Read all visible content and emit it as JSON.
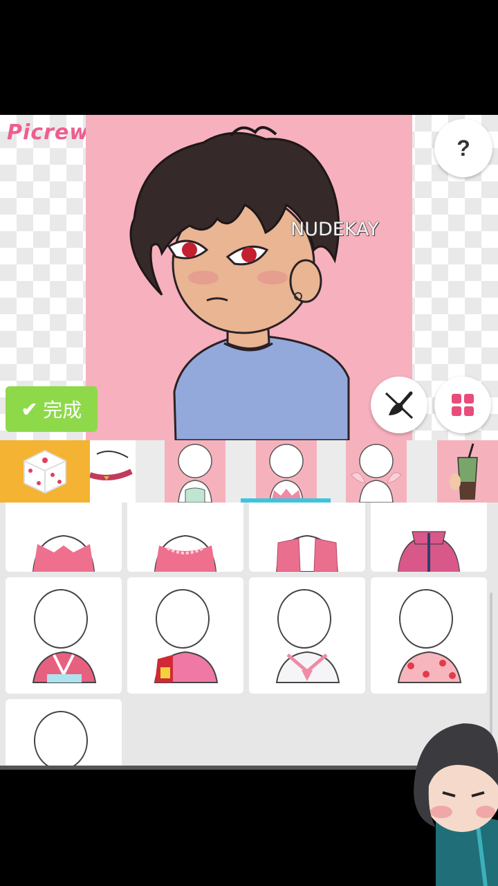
{
  "app": {
    "logo": "Picrew",
    "watermark": "NUDEKAY"
  },
  "buttons": {
    "help_label": "?",
    "done_label": "完成",
    "done_icon": "check-icon",
    "brush_icon": "brush-toggle-icon",
    "grid_icon": "grid-icon",
    "random_icon": "dice-icon"
  },
  "category_tabs": [
    {
      "name": "choker",
      "selected": false
    },
    {
      "name": "inner-shirt",
      "selected": false
    },
    {
      "name": "outer-top",
      "selected": true
    },
    {
      "name": "wings",
      "selected": false
    },
    {
      "name": "bubble-tea",
      "selected": false
    }
  ],
  "items": [
    "pink-tshirt",
    "pink-frill-top",
    "pink-open-jacket",
    "pink-track-jacket",
    "pink-kimono",
    "pink-bomber-jacket",
    "sailor-top",
    "strawberry-shirt",
    "partial-item"
  ],
  "colors": {
    "portrait_bg": "#f7b0be",
    "done_green": "#8ed94a",
    "dice_orange": "#f4b332",
    "tab_indicator": "#3ec4dc",
    "logo_pink": "#ee5f8d"
  }
}
